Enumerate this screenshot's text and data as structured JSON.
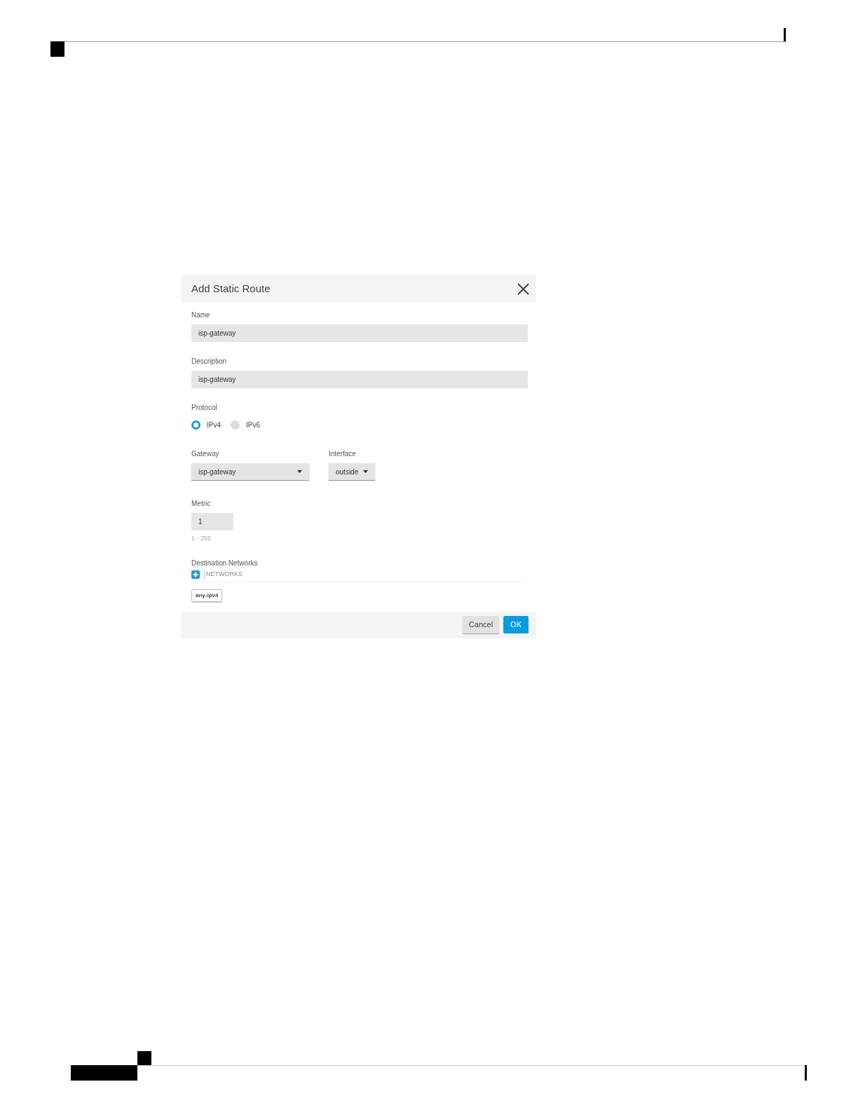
{
  "dialog": {
    "title": "Add Static Route",
    "name": {
      "label": "Name",
      "value": "isp-gateway"
    },
    "description": {
      "label": "Description",
      "value": "isp-gateway"
    },
    "protocol": {
      "label": "Protocol",
      "options": [
        {
          "label": "IPv4",
          "selected": true
        },
        {
          "label": "IPv6",
          "selected": false
        }
      ]
    },
    "gateway": {
      "label": "Gateway",
      "value": "isp-gateway"
    },
    "interface": {
      "label": "Interface",
      "value": "outside"
    },
    "metric": {
      "label": "Metric",
      "value": "1",
      "hint": "1 - 255"
    },
    "destination": {
      "label": "Destination Networks",
      "placeholder": "NETWORKS",
      "items": [
        "any-ipv4"
      ]
    },
    "buttons": [
      {
        "label": "Cancel",
        "kind": "secondary"
      },
      {
        "label": "OK",
        "kind": "primary"
      }
    ]
  }
}
